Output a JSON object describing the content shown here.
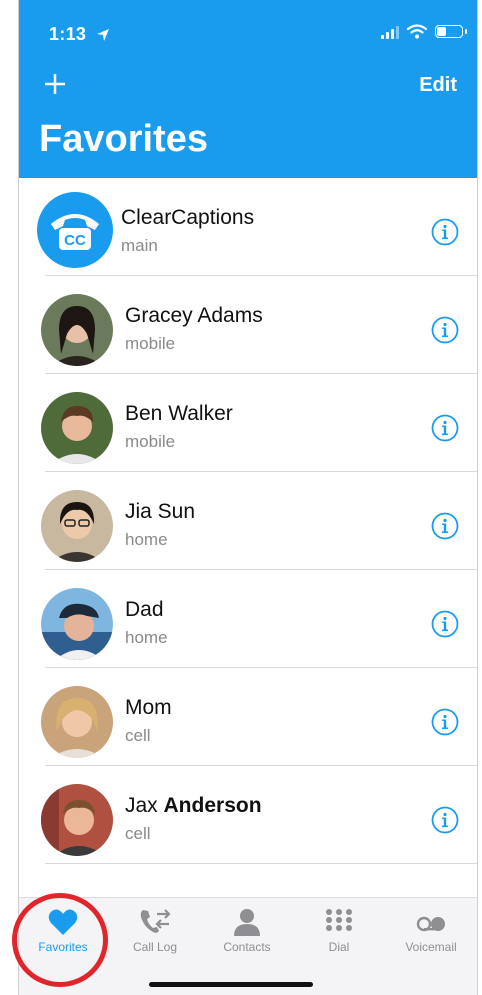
{
  "status_bar": {
    "time": "1:13"
  },
  "header": {
    "add_label": "+",
    "edit_label": "Edit",
    "title": "Favorites",
    "accent_color": "#1a9cee"
  },
  "favorites": [
    {
      "name": "ClearCaptions",
      "name_bold": "",
      "type": "main",
      "avatar_icon": "clearcaptions-logo-icon",
      "avatar_bg": "#1a9cee"
    },
    {
      "name": "Gracey Adams",
      "name_bold": "",
      "type": "mobile",
      "avatar_bg": "#6b7a5a"
    },
    {
      "name": "Ben Walker",
      "name_bold": "",
      "type": "mobile",
      "avatar_bg": "#4f6b3a"
    },
    {
      "name": "Jia Sun",
      "name_bold": "",
      "type": "home",
      "avatar_bg": "#c8b8a0"
    },
    {
      "name": "Dad",
      "name_bold": "",
      "type": "home",
      "avatar_bg": "#3e7fc0"
    },
    {
      "name": "Mom",
      "name_bold": "",
      "type": "cell",
      "avatar_bg": "#c9a37a"
    },
    {
      "name": "Jax ",
      "name_bold": "Anderson",
      "type": "cell",
      "avatar_bg": "#b05040"
    }
  ],
  "tabs": [
    {
      "label": "Favorites",
      "icon": "heart-icon",
      "active": true
    },
    {
      "label": "Call Log",
      "icon": "call-log-icon",
      "active": false
    },
    {
      "label": "Contacts",
      "icon": "person-icon",
      "active": false
    },
    {
      "label": "Dial",
      "icon": "keypad-icon",
      "active": false
    },
    {
      "label": "Voicemail",
      "icon": "voicemail-icon",
      "active": false
    }
  ]
}
